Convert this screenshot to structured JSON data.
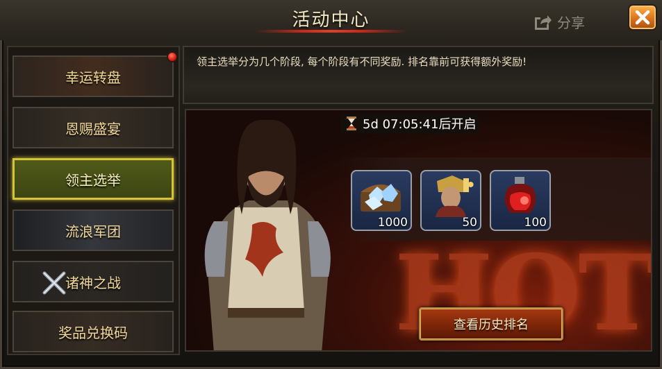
{
  "header": {
    "title": "活动中心",
    "share_label": "分享"
  },
  "sidebar": {
    "items": [
      {
        "label": "幸运转盘",
        "has_badge": true
      },
      {
        "label": "恩赐盛宴"
      },
      {
        "label": "领主选举",
        "active": true
      },
      {
        "label": "流浪军团"
      },
      {
        "label": "诸神之战"
      },
      {
        "label": "奖品兑换码"
      }
    ]
  },
  "description": {
    "text": "领主选举分为几个阶段, 每个阶段有不同奖励. 排名靠前可获得额外奖励!"
  },
  "banner": {
    "timer": "5d 07:05:41后开启",
    "hot_text": "HOT",
    "rewards": [
      {
        "icon": "gem-chest-icon",
        "qty": "1000"
      },
      {
        "icon": "commander-puzzle-icon",
        "qty": "50"
      },
      {
        "icon": "red-potion-icon",
        "qty": "100"
      }
    ],
    "history_button": "查看历史排名"
  },
  "colors": {
    "accent": "#d6c33a",
    "close_orange": "#e0801f",
    "button_red": "#8a2a0a"
  }
}
